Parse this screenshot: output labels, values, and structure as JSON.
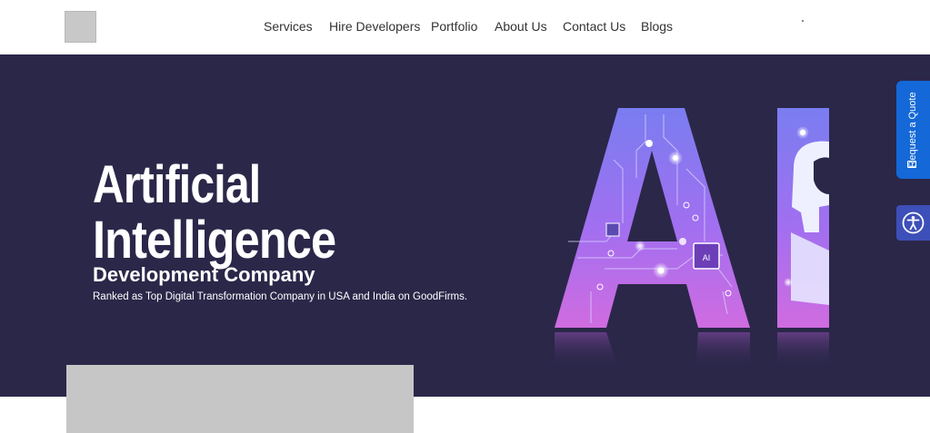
{
  "header": {
    "logo_icon": "logo-placeholder",
    "nav": [
      "Services",
      "Hire Developers",
      "Portfolio",
      "About Us",
      "Contact Us",
      "Blogs"
    ]
  },
  "hero": {
    "title_line1": "Artificial",
    "title_line2": "Intelligence",
    "subtitle": "Development Company",
    "description": "Ranked as Top Digital Transformation Company in USA and India on GoodFirms.",
    "graphic_chip_label": "AI",
    "background_color": "#2b2749"
  },
  "side_widgets": {
    "quote_label": "Request a Quote",
    "quote_icon": "envelope-icon",
    "quote_color": "#1468d8",
    "accessibility_icon": "accessibility-icon",
    "accessibility_color": "#3d4fb8"
  },
  "content": {
    "placeholder": "image-placeholder"
  }
}
